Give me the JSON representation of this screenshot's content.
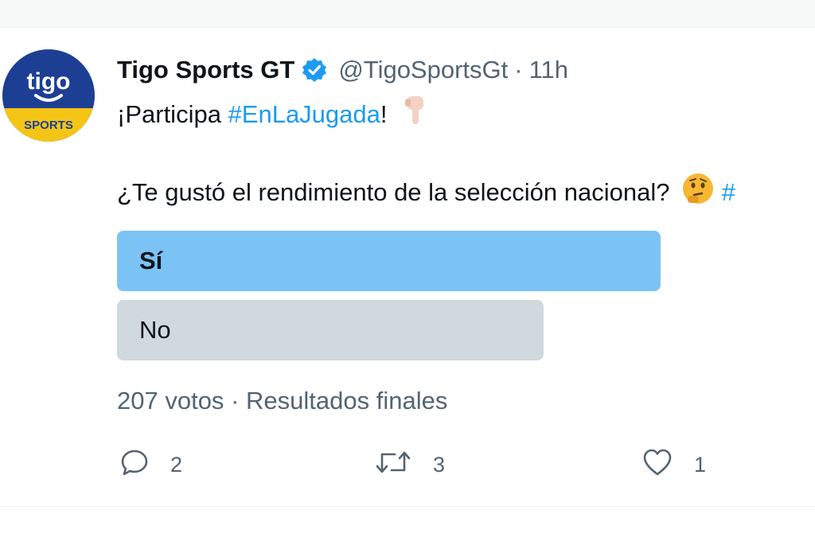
{
  "tweet": {
    "display_name": "Tigo Sports GT",
    "handle": "@TigoSportsGt",
    "separator": "·",
    "time": "11h",
    "intro_prefix": "¡Participa ",
    "hashtag": "#EnLaJugada",
    "intro_suffix": "!",
    "question": "¿Te gustó el rendimiento de la selección nacional?",
    "trailing_hashtag_fragment": "#",
    "avatar": {
      "brand_top": "tigo",
      "brand_bottom": "SPORTS",
      "navy": "#1c3f94",
      "yellow": "#f5c516"
    },
    "verified_color": "#1d9bf0"
  },
  "poll": {
    "options": [
      {
        "label": "Sí",
        "share_fraction": 0.67,
        "winner": true,
        "color": "#7cc3f5"
      },
      {
        "label": "No",
        "share_fraction": 0.53,
        "winner": false,
        "color": "#cfd9de"
      }
    ],
    "votes": "207 votos",
    "separator": "·",
    "status": "Resultados finales"
  },
  "actions": {
    "replies": "2",
    "retweets": "3",
    "likes": "1",
    "icons": [
      "reply-icon",
      "retweet-icon",
      "like-icon"
    ]
  }
}
